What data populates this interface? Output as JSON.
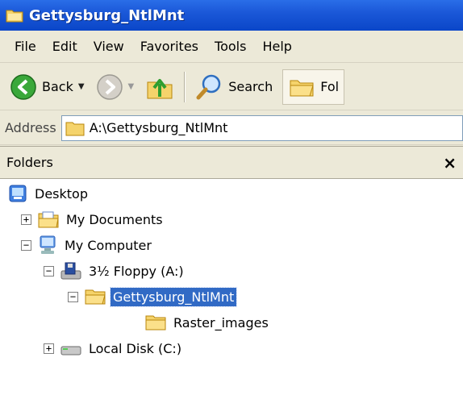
{
  "window": {
    "title": "Gettysburg_NtlMnt"
  },
  "menu": [
    "File",
    "Edit",
    "View",
    "Favorites",
    "Tools",
    "Help"
  ],
  "toolbar": {
    "back_label": "Back",
    "search_label": "Search",
    "folders_label": "Fol"
  },
  "address": {
    "label": "Address",
    "value": "A:\\Gettysburg_NtlMnt"
  },
  "folders_pane": {
    "header": "Folders",
    "close_glyph": "×"
  },
  "tree": {
    "desktop": "Desktop",
    "my_documents": "My Documents",
    "my_computer": "My Computer",
    "floppy": "3½ Floppy (A:)",
    "gettysburg": "Gettysburg_NtlMnt",
    "raster": "Raster_images",
    "local_disk": "Local Disk (C:)",
    "expand_plus": "+",
    "expand_minus": "−"
  }
}
